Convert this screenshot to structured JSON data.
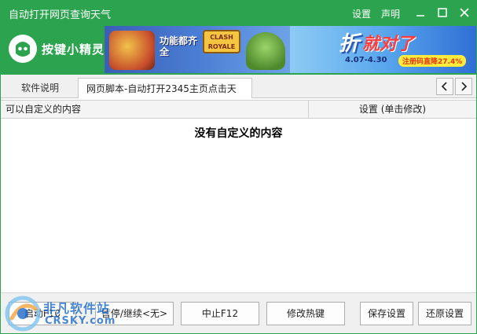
{
  "window": {
    "title": "自动打开网页查询天气",
    "settings_label": "设置",
    "about_label": "声明",
    "accent_color": "#2ca44f"
  },
  "brand": {
    "name": "按键小精灵",
    "icon": "app-logo-icon"
  },
  "banner": {
    "left_slogan": "功能都齐全",
    "left_game_logo": "CLASH ROYALE",
    "right_headline_1": "折",
    "right_headline_2": "就对了",
    "right_dates": "4.07-4.30",
    "right_promo": "注册码直降27.4%"
  },
  "tabs": [
    {
      "label": "软件说明",
      "active": false
    },
    {
      "label": "网页脚本-自动打开2345主页点击天气",
      "active": true
    }
  ],
  "tab_nav": {
    "prev_icon": "chevron-left-icon",
    "next_icon": "chevron-right-icon"
  },
  "table": {
    "columns": [
      "可以自定义的内容",
      "设置 (单击修改)"
    ],
    "rows": [],
    "empty_message": "没有自定义的内容"
  },
  "buttons": {
    "start": "启动F10",
    "pause": "暂停/继续<无>",
    "stop": "中止F12",
    "hotkey": "修改热键",
    "save": "保存设置",
    "restore": "还原设置"
  },
  "watermark": {
    "title": "非凡软件站",
    "subtitle": "CRSKY.com"
  }
}
